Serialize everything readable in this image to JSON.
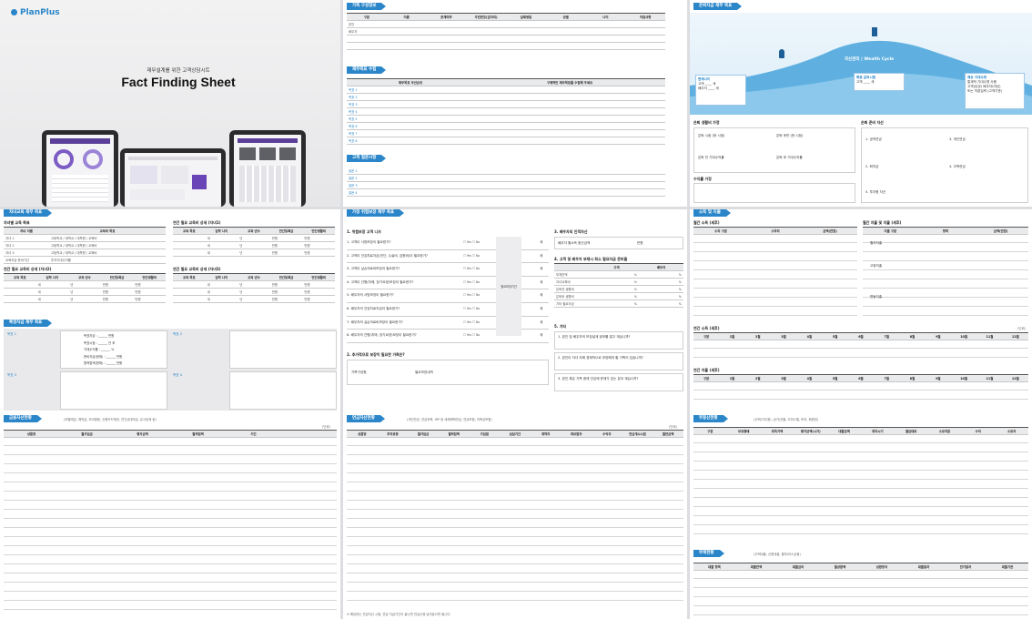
{
  "cover": {
    "logo": "PlanPlus",
    "subtitle": "재무설계를 위한 고객상담시트",
    "title": "Fact Finding Sheet"
  },
  "family": {
    "title": "가족 구성정보",
    "cols": [
      "구분",
      "이름",
      "관계여부",
      "주민번호(앞자리)",
      "실제생일",
      "성별",
      "나이",
      "직업사항"
    ],
    "rows": [
      "본인",
      "배우자"
    ]
  },
  "goals": {
    "title": "재무목표 수립",
    "col1": "재무목표 우선순위",
    "col2": "구체적인 재무목표를 수립해 주세요",
    "rows": [
      "목표 1",
      "목표 2",
      "목표 3",
      "목표 4",
      "목표 5",
      "목표 6",
      "목표 7",
      "목표 8"
    ]
  },
  "questions": {
    "title": "고객 질문사항",
    "rows": [
      "질문 1",
      "질문 2",
      "질문 3",
      "질문 4"
    ]
  },
  "retire": {
    "title": "은퇴자금 재무 목표",
    "cycle": "자산관리 | Wealth Cycle",
    "box1_title": "현재나이",
    "box1_a": "고객",
    "box1_b": "배우자",
    "box2_title": "목표 은퇴시점",
    "box2_a": "고객",
    "box3_title": "예상 기대수명",
    "box3_a": "통계적 기대수명 사용",
    "box3_b": "고객(남성) 배우자(여성)",
    "box3_c": "또는 직접입력 (고객기준)",
    "unit_age": "세",
    "sec_a": "은퇴 생활비 가정",
    "sec_b": "은퇴 준비 자산",
    "sec_c": "수익률 가정",
    "labels_a": [
      "은퇴 시점 (현 시점)",
      "은퇴 후반 (현 시점)",
      "은퇴 전 기대수익률",
      "은퇴 후 기대수익률"
    ],
    "labels_b": [
      "1. 공적연금",
      "2. 퇴직금",
      "3. 개인연금",
      "4. 주택연금",
      "5. 투자형 자산"
    ]
  },
  "children": {
    "title": "자녀교육 재무 목표",
    "sub1": "자녀별 교육 목표",
    "cols1": [
      "자녀 이름",
      "교육비 목표"
    ],
    "rows1": [
      "자녀 1",
      "자녀 2",
      "자녀 3"
    ],
    "edu_note": "고등학교 / 대학교 / 대학원 / 교육비",
    "sum_label": "교육자금 준비기간",
    "sum_rate": "투자기대수익률",
    "sub2": "연간 필요 교육비 상세 (자녀1)",
    "sub3": "연간 필요 교육비 상세 (자녀2)",
    "sub4": "연간 필요 교육비 상세 (자녀3)",
    "cols2": [
      "교육 목표",
      "입학 나이",
      "교육 년수",
      "연간교육비"
    ],
    "cols2b": [
      "연간등록금",
      "연간생활비"
    ],
    "unit_year": "세",
    "unit_n": "년",
    "unit_won": "만원"
  },
  "specific": {
    "title": "특정자금 재무 목표",
    "goals": [
      "목표 1",
      "목표 2",
      "목표 3",
      "목표 4"
    ],
    "fields": [
      "목표자금 :",
      "목표시점 :",
      "기대수익률 :",
      "준비자금(현재) :",
      "월적립액(현재) :"
    ],
    "units": [
      "만원",
      "년 후",
      "%",
      "만원",
      "만원"
    ]
  },
  "assets": {
    "title": "금융자산현황",
    "note": "(보통예금, 예적금, 외국환등, 신용카드채권, 연간금대여금, 유사공제 등)",
    "unit": "(단위)",
    "cols": [
      "상품명",
      "월가입금",
      "평가금액",
      "월적립액",
      "기간"
    ]
  },
  "insurance": {
    "title": "가정 위험보장 재무 목표",
    "sub1": "1. 위험보장 고객 니즈",
    "q": [
      "1. 고객이 사망보장이 필요한가?",
      "2. 고객이 건강치료자금(진단, 수술비, 입원비)이 필요한가?",
      "3. 고객이 실손의료비보장이 필요한가?",
      "4. 고객이 간병(치매, 장기요양)보장이 필요한가?",
      "5. 배우자의 사망보장이 필요한가?",
      "6. 배우자의 건강치료자금이 필요한가?",
      "7. 배우자의 실손의료비보장이 필요한가?",
      "8. 배우자의 간병(치매, 장기요양)보장이 필요한가?"
    ],
    "yes": "☐ Yes ☐ No",
    "need_label": "필요보장기간",
    "unit_year": "세",
    "sub2": "2. 추가적으로 보장이 필요한 가족은?",
    "sub2_cols": [
      "가족구성원",
      "필요보장내역"
    ],
    "sub3": "3. 배우자의 인적자산",
    "sub3_label": "배우자 월소득 환산금액",
    "sub3_unit": "만원",
    "sub4": "4. 고객 및 배우자 부재시 최소 필요자금 준비율",
    "sub4_cols": [
      "고객",
      "배우자"
    ],
    "sub4_rows": [
      "부채잔액",
      "자녀교육비",
      "은퇴전 생활비",
      "은퇴후 생활비",
      "기타 필요자금"
    ],
    "sub5": "5. 기타",
    "sub5_q": [
      "1. 본인 및 배우자의 보장설계 정보를 알고 계십니까?",
      "2. 본인이 자녀 외에 경제적으로 부양해야 할 가족이 있습니까?",
      "3. 본인 혹은 가족 중에 건강에 문제가 있는 분이 계십니까?"
    ],
    "unit_pct": "%"
  },
  "investment": {
    "title": "연금자산현황",
    "note": "(개인연금, 연금저축, IRP 등 세제혜택연금, 연금보험, 저축성보험)",
    "unit": "(단위)",
    "cols": [
      "상품명",
      "투자유형",
      "월가입금",
      "월적립액",
      "가입일",
      "납입기간",
      "계약자",
      "피보험자",
      "수익자",
      "연금개시시점",
      "월연금액"
    ],
    "foot": "※ 해당하는 연금자산 시점, 연금 지급기간이 끝나면 연금수령 남겨놓으면 됩니다."
  },
  "income": {
    "title": "소득 및 지출",
    "sub1": "월간 소득 (세후)",
    "cols1": [
      "소득 구분",
      "소득처",
      "금액(만원)"
    ],
    "sub2": "월간 지출 및 지출 (세후)",
    "cols2": [
      "지출 구분",
      "항목",
      "금액(만원)"
    ],
    "cats": [
      "월지지출",
      "고정지출",
      "변동지출"
    ],
    "sub3": "연간 소득 (세후)",
    "sub4": "연간 지출 (세후)",
    "months": [
      "구분",
      "1월",
      "2월",
      "3월",
      "4월",
      "5월",
      "6월",
      "7월",
      "8월",
      "9월",
      "10월",
      "11월",
      "12월"
    ],
    "unit": "(단위)"
  },
  "realestate": {
    "title": "부동산현황",
    "note": "(주택(거주용), 상가/건물, 오피스텔, 토지, 회원권)",
    "cols": [
      "구분",
      "보유형태",
      "취득가액",
      "평가금액(시가)",
      "대출금액",
      "취득시기",
      "월임대료",
      "소유지분",
      "수익",
      "소유자"
    ]
  },
  "debt": {
    "title": "부채현황",
    "note": "(주택대출, 신용대출, 할부/리스금융)",
    "cols": [
      "대출 항목",
      "대출잔액",
      "대출금리",
      "월상환액",
      "상환방식",
      "대출일자",
      "만기일자",
      "대출기관"
    ]
  }
}
